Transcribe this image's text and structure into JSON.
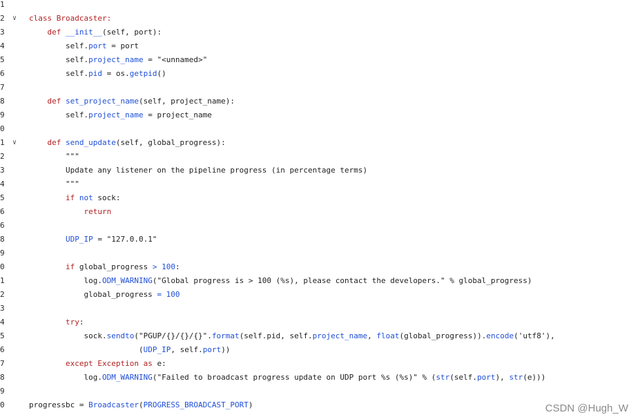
{
  "editor": {
    "lines": [
      {
        "n": "1",
        "fold": "",
        "segments": []
      },
      {
        "n": "2",
        "fold": "∨",
        "segments": [
          {
            "t": "class ",
            "c": "kw"
          },
          {
            "t": "Broadcaster:",
            "c": "kw"
          }
        ]
      },
      {
        "n": "3",
        "fold": "",
        "segments": [
          {
            "t": "    def ",
            "c": "kw"
          },
          {
            "t": "__init__",
            "c": "nm"
          },
          {
            "t": "(self, port):",
            "c": ""
          }
        ]
      },
      {
        "n": "4",
        "fold": "",
        "segments": [
          {
            "t": "        self.",
            "c": ""
          },
          {
            "t": "port",
            "c": "nm"
          },
          {
            "t": " = port",
            "c": ""
          }
        ]
      },
      {
        "n": "5",
        "fold": "",
        "segments": [
          {
            "t": "        self.",
            "c": ""
          },
          {
            "t": "project_name",
            "c": "nm"
          },
          {
            "t": " = \"<unnamed>\"",
            "c": ""
          }
        ]
      },
      {
        "n": "6",
        "fold": "",
        "segments": [
          {
            "t": "        self.",
            "c": ""
          },
          {
            "t": "pid",
            "c": "nm"
          },
          {
            "t": " = os.",
            "c": ""
          },
          {
            "t": "getpid",
            "c": "nm"
          },
          {
            "t": "()",
            "c": ""
          }
        ]
      },
      {
        "n": "7",
        "fold": "",
        "segments": []
      },
      {
        "n": "8",
        "fold": "",
        "segments": [
          {
            "t": "    def ",
            "c": "kw"
          },
          {
            "t": "set_project_name",
            "c": "nm"
          },
          {
            "t": "(self, project_name):",
            "c": ""
          }
        ]
      },
      {
        "n": "9",
        "fold": "",
        "segments": [
          {
            "t": "        self.",
            "c": ""
          },
          {
            "t": "project_name",
            "c": "nm"
          },
          {
            "t": " = project_name",
            "c": ""
          }
        ]
      },
      {
        "n": "0",
        "fold": "",
        "segments": []
      },
      {
        "n": "1",
        "fold": "∨",
        "segments": [
          {
            "t": "    def ",
            "c": "kw"
          },
          {
            "t": "send_update",
            "c": "nm"
          },
          {
            "t": "(self, global_progress):",
            "c": ""
          }
        ]
      },
      {
        "n": "2",
        "fold": "",
        "segments": [
          {
            "t": "        \"\"\"",
            "c": ""
          }
        ]
      },
      {
        "n": "3",
        "fold": "",
        "segments": [
          {
            "t": "        Update any listener on the pipeline progress (in percentage terms)",
            "c": ""
          }
        ]
      },
      {
        "n": "4",
        "fold": "",
        "segments": [
          {
            "t": "        \"\"\"",
            "c": ""
          }
        ]
      },
      {
        "n": "5",
        "fold": "",
        "segments": [
          {
            "t": "        if ",
            "c": "kw"
          },
          {
            "t": "not ",
            "c": "nm"
          },
          {
            "t": "sock:",
            "c": ""
          }
        ]
      },
      {
        "n": "6",
        "fold": "",
        "segments": [
          {
            "t": "            return",
            "c": "kw"
          }
        ]
      },
      {
        "n": "6",
        "fold": "",
        "segments": []
      },
      {
        "n": "8",
        "fold": "",
        "segments": [
          {
            "t": "        UDP_IP",
            "c": "nm"
          },
          {
            "t": " = \"127.0.0.1\"",
            "c": ""
          }
        ]
      },
      {
        "n": "9",
        "fold": "",
        "segments": []
      },
      {
        "n": "0",
        "fold": "",
        "segments": [
          {
            "t": "        if ",
            "c": "kw"
          },
          {
            "t": "global_progress ",
            "c": ""
          },
          {
            "t": "> 100",
            "c": "nm"
          },
          {
            "t": ":",
            "c": ""
          }
        ]
      },
      {
        "n": "1",
        "fold": "",
        "segments": [
          {
            "t": "            log.",
            "c": ""
          },
          {
            "t": "ODM_WARNING",
            "c": "nm"
          },
          {
            "t": "(\"Global progress is > 100 (%s), please contact the developers.\" % global_progress)",
            "c": ""
          }
        ]
      },
      {
        "n": "2",
        "fold": "",
        "segments": [
          {
            "t": "            global_progress ",
            "c": ""
          },
          {
            "t": "= 100",
            "c": "nm"
          }
        ]
      },
      {
        "n": "3",
        "fold": "",
        "segments": []
      },
      {
        "n": "4",
        "fold": "",
        "segments": [
          {
            "t": "        try",
            "c": "kw"
          },
          {
            "t": ":",
            "c": ""
          }
        ]
      },
      {
        "n": "5",
        "fold": "",
        "segments": [
          {
            "t": "            sock.",
            "c": ""
          },
          {
            "t": "sendto",
            "c": "nm"
          },
          {
            "t": "(\"PGUP/{}/{}/{}\".",
            "c": ""
          },
          {
            "t": "format",
            "c": "nm"
          },
          {
            "t": "(self.pid, self.",
            "c": ""
          },
          {
            "t": "project_name",
            "c": "nm"
          },
          {
            "t": ", ",
            "c": ""
          },
          {
            "t": "float",
            "c": "nm"
          },
          {
            "t": "(global_progress)).",
            "c": ""
          },
          {
            "t": "encode",
            "c": "nm"
          },
          {
            "t": "('utf8'),",
            "c": ""
          }
        ]
      },
      {
        "n": "6",
        "fold": "",
        "segments": [
          {
            "t": "                        (",
            "c": ""
          },
          {
            "t": "UDP_IP",
            "c": "nm"
          },
          {
            "t": ", self.",
            "c": ""
          },
          {
            "t": "port",
            "c": "nm"
          },
          {
            "t": "))",
            "c": ""
          }
        ]
      },
      {
        "n": "7",
        "fold": "",
        "segments": [
          {
            "t": "        except ",
            "c": "kw"
          },
          {
            "t": "Exception ",
            "c": "kw"
          },
          {
            "t": "as ",
            "c": "kw"
          },
          {
            "t": "e:",
            "c": ""
          }
        ]
      },
      {
        "n": "8",
        "fold": "",
        "segments": [
          {
            "t": "            log.",
            "c": ""
          },
          {
            "t": "ODM_WARNING",
            "c": "nm"
          },
          {
            "t": "(\"Failed to broadcast progress update on UDP port %s (%s)\" % (",
            "c": ""
          },
          {
            "t": "str",
            "c": "nm"
          },
          {
            "t": "(self.",
            "c": ""
          },
          {
            "t": "port",
            "c": "nm"
          },
          {
            "t": "), ",
            "c": ""
          },
          {
            "t": "str",
            "c": "nm"
          },
          {
            "t": "(e)))",
            "c": ""
          }
        ]
      },
      {
        "n": "9",
        "fold": "",
        "segments": []
      },
      {
        "n": "0",
        "fold": "",
        "segments": [
          {
            "t": "progressbc = ",
            "c": ""
          },
          {
            "t": "Broadcaster",
            "c": "nm"
          },
          {
            "t": "(",
            "c": ""
          },
          {
            "t": "PROGRESS_BROADCAST_PORT",
            "c": "nm"
          },
          {
            "t": ")",
            "c": ""
          }
        ]
      }
    ]
  },
  "watermark": "CSDN @Hugh_W"
}
